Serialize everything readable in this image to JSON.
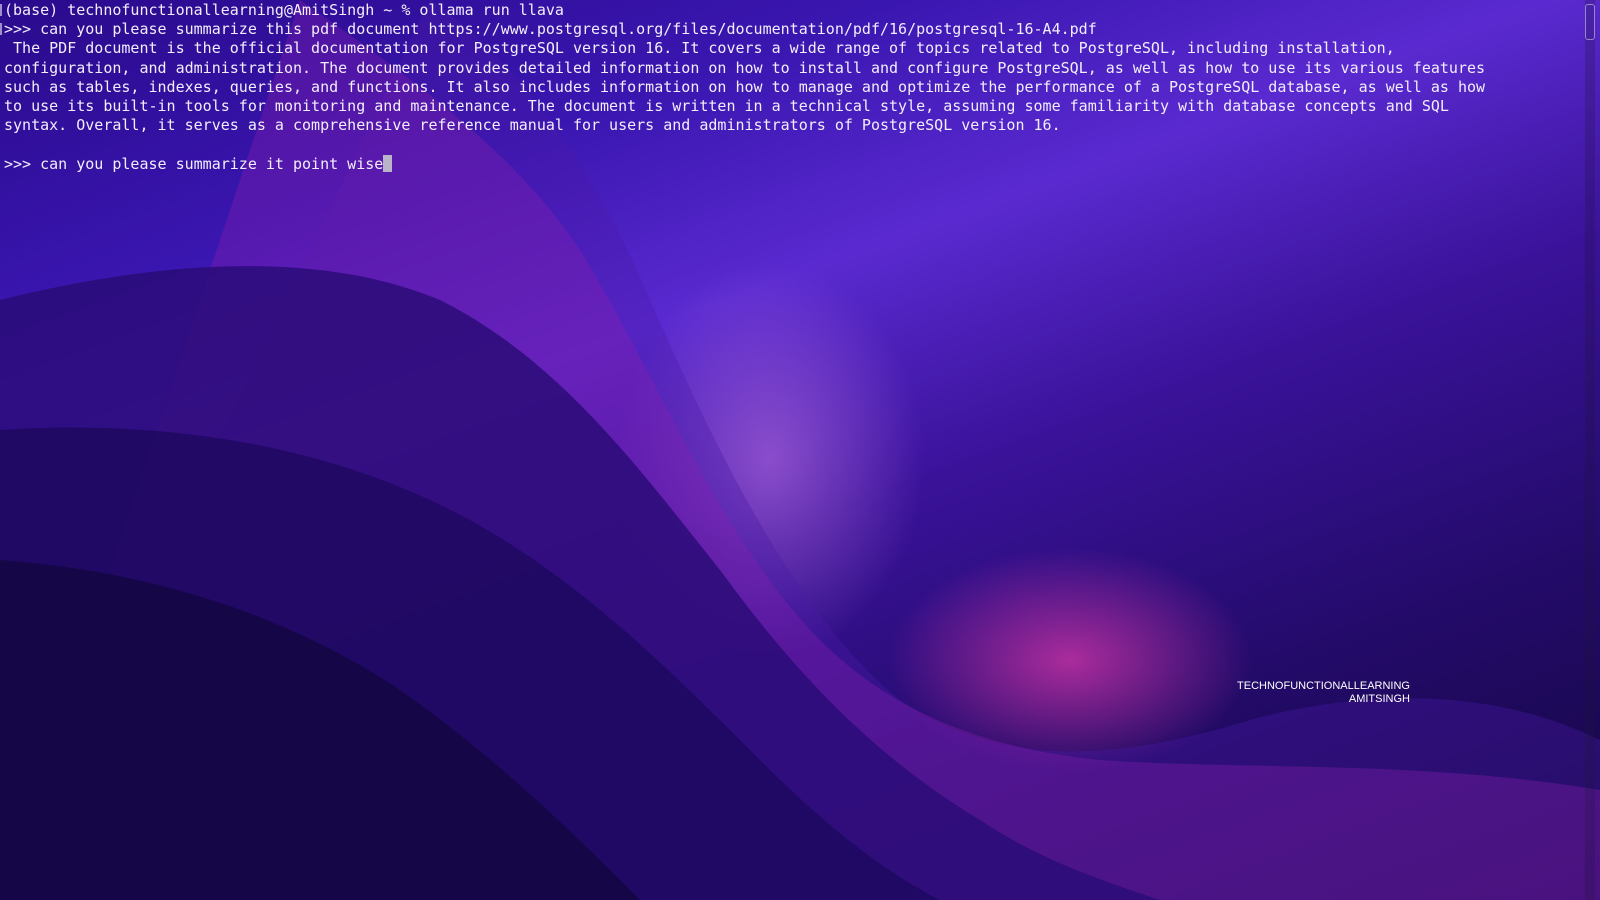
{
  "terminal": {
    "prompt_line": "(base) technofunctionallearning@AmitSingh ~ % ollama run llava",
    "user_query_1": ">>> can you please summarize this pdf document https://www.postgresql.org/files/documentation/pdf/16/postgresql-16-A4.pdf",
    "response_lines": [
      " The PDF document is the official documentation for PostgreSQL version 16. It covers a wide range of topics related to PostgreSQL, including installation,",
      "configuration, and administration. The document provides detailed information on how to install and configure PostgreSQL, as well as how to use its various features",
      "such as tables, indexes, queries, and functions. It also includes information on how to manage and optimize the performance of a PostgreSQL database, as well as how",
      "to use its built-in tools for monitoring and maintenance. The document is written in a technical style, assuming some familiarity with database concepts and SQL",
      "syntax. Overall, it serves as a comprehensive reference manual for users and administrators of PostgreSQL version 16."
    ],
    "current_input": ">>> can you please summarize it point wise"
  },
  "watermark": {
    "line1": "TECHNOFUNCTIONALLEARNING",
    "line2": "AMITSINGH"
  }
}
